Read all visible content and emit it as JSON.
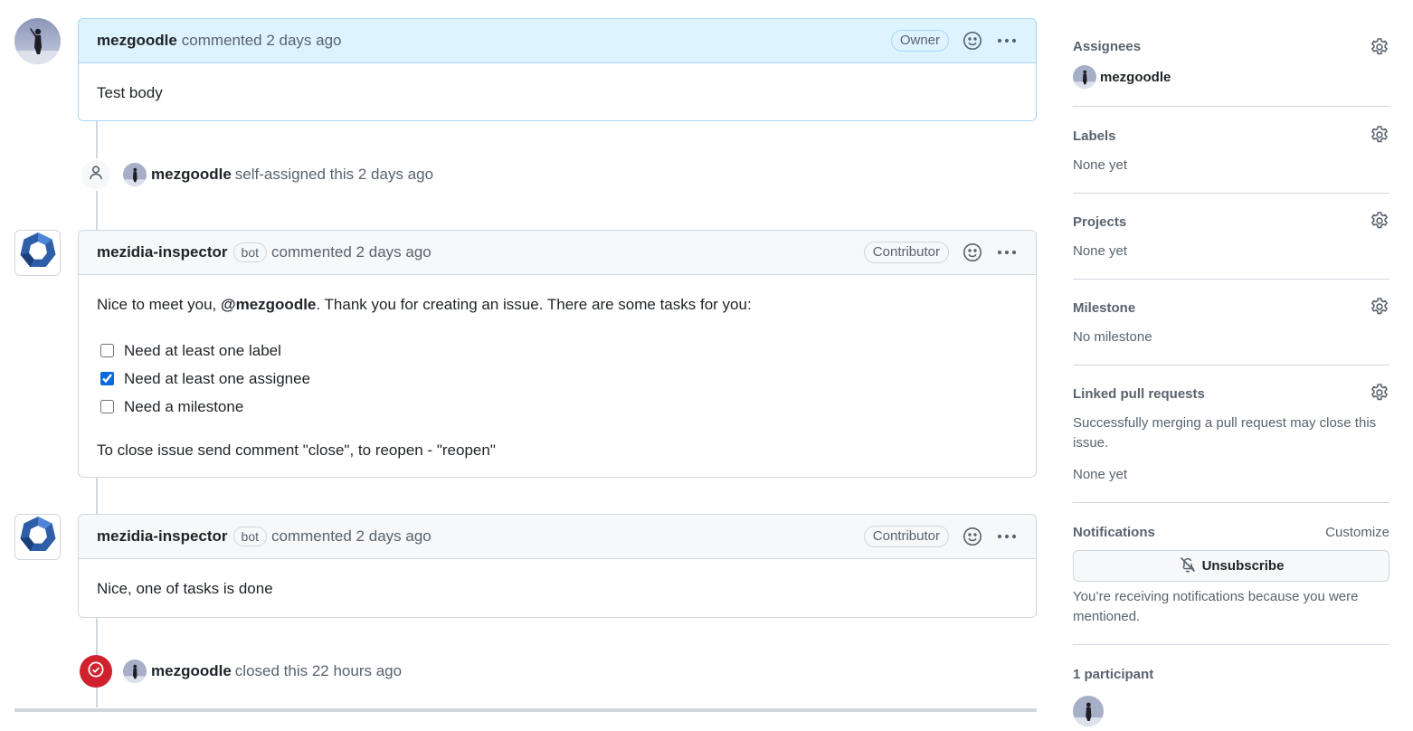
{
  "timeline": {
    "comment1": {
      "author": "mezgoodle",
      "meta": "commented 2 days ago",
      "role": "Owner",
      "body": "Test body"
    },
    "event1": {
      "author": "mezgoodle",
      "text": "self-assigned this 2 days ago"
    },
    "comment2": {
      "author": "mezidia-inspector",
      "bot_label": "bot",
      "meta": "commented 2 days ago",
      "role": "Contributor",
      "intro_prefix": "Nice to meet you, ",
      "mention": "@mezgoodle",
      "intro_suffix": ". Thank you for creating an issue. There are some tasks for you:",
      "tasks": [
        {
          "label": "Need at least one label",
          "checked": false
        },
        {
          "label": "Need at least one assignee",
          "checked": true
        },
        {
          "label": "Need a milestone",
          "checked": false
        }
      ],
      "outro": "To close issue send comment \"close\", to reopen - \"reopen\""
    },
    "comment3": {
      "author": "mezidia-inspector",
      "bot_label": "bot",
      "meta": "commented 2 days ago",
      "role": "Contributor",
      "body": "Nice, one of tasks is done"
    },
    "event2": {
      "author": "mezgoodle",
      "text": "closed this 22 hours ago"
    }
  },
  "sidebar": {
    "assignees": {
      "title": "Assignees",
      "user": "mezgoodle"
    },
    "labels": {
      "title": "Labels",
      "value": "None yet"
    },
    "projects": {
      "title": "Projects",
      "value": "None yet"
    },
    "milestone": {
      "title": "Milestone",
      "value": "No milestone"
    },
    "linked_prs": {
      "title": "Linked pull requests",
      "description": "Successfully merging a pull request may close this issue.",
      "value": "None yet"
    },
    "notifications": {
      "title": "Notifications",
      "customize": "Customize",
      "button": "Unsubscribe",
      "reason": "You’re receiving notifications because you were mentioned."
    },
    "participants": {
      "title": "1 participant"
    }
  },
  "icons": {
    "gear": "gear-icon",
    "smiley": "smiley-icon",
    "kebab": "kebab-horizontal-icon",
    "person": "person-icon",
    "closed": "issue-closed-icon",
    "bell_slash": "bell-slash-icon",
    "bot_avatar": "heptagon-logo-icon"
  },
  "colors": {
    "owner_header": "#ddf4ff",
    "owner_border": "#a9d6f5",
    "closed_badge": "#cf222e",
    "bot_logo": "#2f5ea8",
    "checkbox": "#0969da"
  }
}
